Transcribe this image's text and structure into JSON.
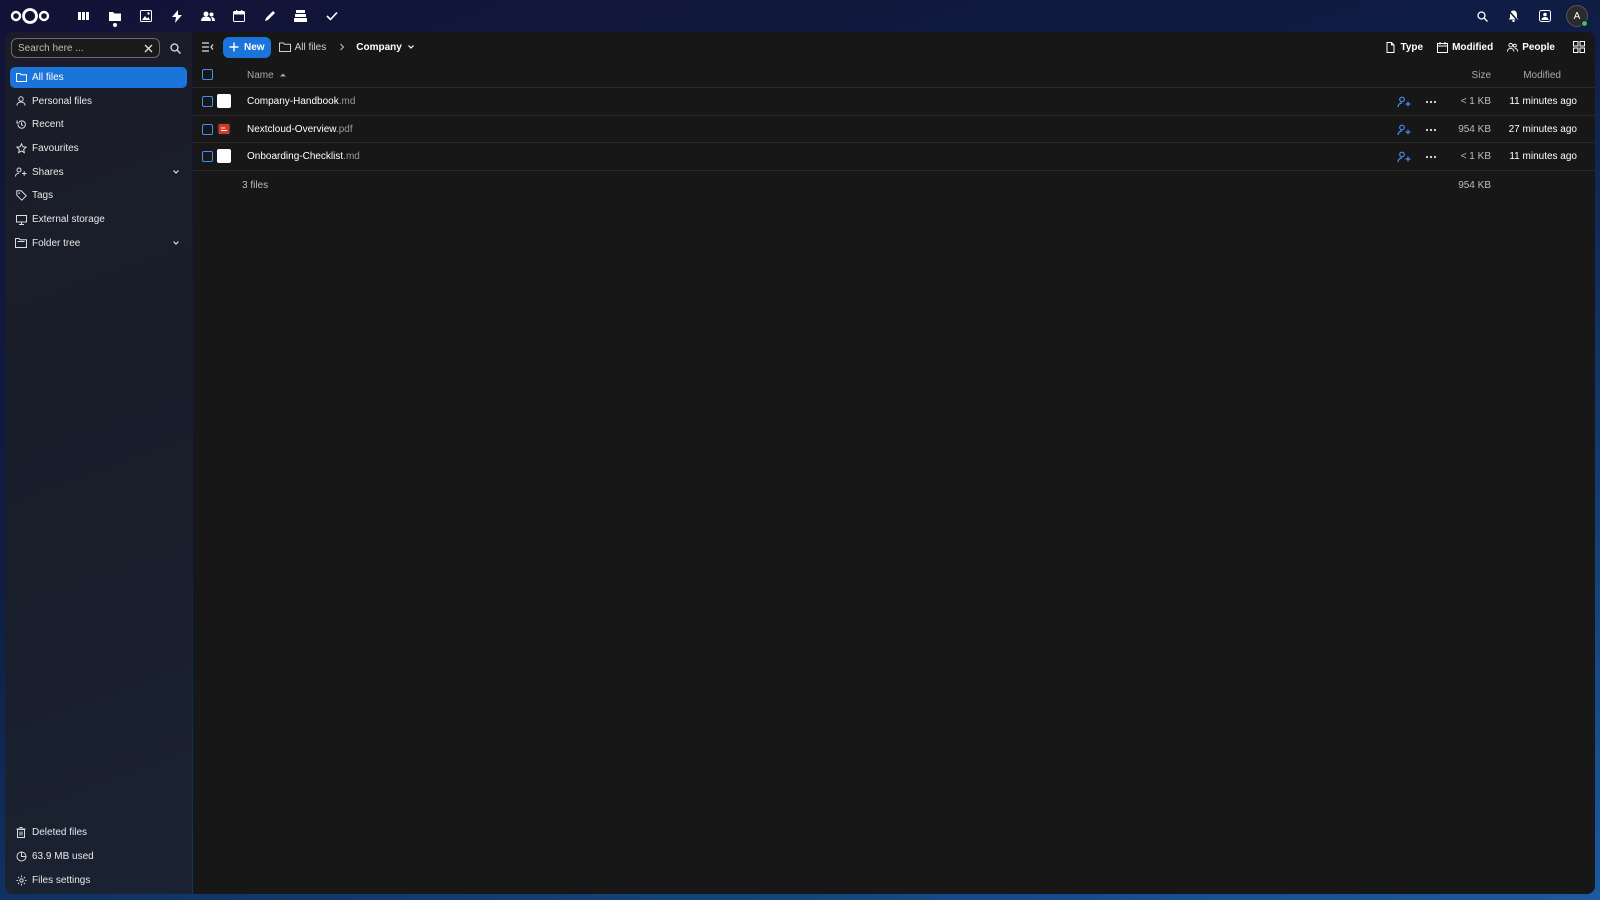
{
  "header": {
    "apps": [
      {
        "name": "dashboard-app-icon"
      },
      {
        "name": "files-app-icon",
        "active": true
      },
      {
        "name": "photos-app-icon"
      },
      {
        "name": "activity-app-icon"
      },
      {
        "name": "contacts-app-icon"
      },
      {
        "name": "calendar-app-icon"
      },
      {
        "name": "notes-app-icon"
      },
      {
        "name": "deck-app-icon"
      },
      {
        "name": "tasks-app-icon"
      }
    ],
    "avatar_letter": "A"
  },
  "sidebar": {
    "search_placeholder": "Search here ...",
    "items": [
      {
        "label": "All files",
        "icon": "folder-icon",
        "active": true
      },
      {
        "label": "Personal files",
        "icon": "person-icon"
      },
      {
        "label": "Recent",
        "icon": "history-icon"
      },
      {
        "label": "Favourites",
        "icon": "star-icon"
      },
      {
        "label": "Shares",
        "icon": "share-icon",
        "expandable": true
      },
      {
        "label": "Tags",
        "icon": "tag-icon"
      },
      {
        "label": "External storage",
        "icon": "monitor-icon"
      },
      {
        "label": "Folder tree",
        "icon": "folder-tree-icon",
        "expandable": true
      }
    ],
    "bottom": {
      "deleted_label": "Deleted files",
      "quota_label": "63.9 MB used",
      "settings_label": "Files settings"
    }
  },
  "toolbar": {
    "new_label": "New",
    "breadcrumb_root": "All files",
    "breadcrumb_current": "Company",
    "filters": {
      "type_label": "Type",
      "modified_label": "Modified",
      "people_label": "People"
    }
  },
  "table": {
    "headers": {
      "name": "Name",
      "size": "Size",
      "modified": "Modified"
    },
    "rows": [
      {
        "base": "Company-Handbook",
        "ext": ".md",
        "kind": "text",
        "size": "< 1 KB",
        "modified": "11 minutes ago"
      },
      {
        "base": "Nextcloud-Overview",
        "ext": ".pdf",
        "kind": "pdf",
        "size": "954 KB",
        "modified": "27 minutes ago"
      },
      {
        "base": "Onboarding-Checklist",
        "ext": ".md",
        "kind": "text",
        "size": "< 1 KB",
        "modified": "11 minutes ago"
      }
    ],
    "summary": {
      "count": "3 files",
      "total": "954 KB"
    }
  },
  "colors": {
    "accent": "#1a74d9",
    "main_bg": "#171717",
    "pdf_red": "#d33a2c"
  }
}
